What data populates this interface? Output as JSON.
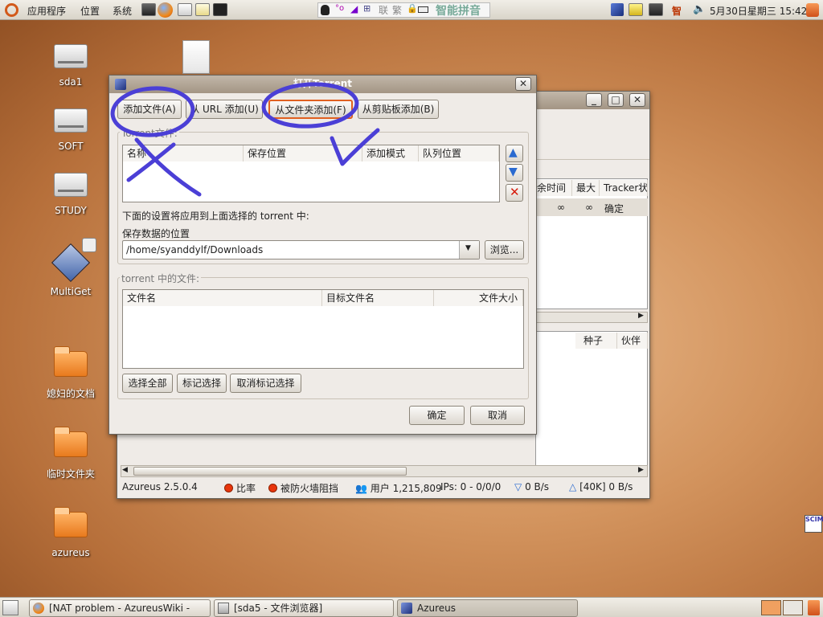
{
  "top_panel": {
    "menus": [
      "应用程序",
      "位置",
      "系统"
    ],
    "ime_label": "智能拼音",
    "ime_keys": [
      "联",
      "繁"
    ],
    "clock": "5月30日星期三 15:42",
    "zhi": "智"
  },
  "desktop": {
    "icons": [
      "sda1",
      "SOFT",
      "STUDY",
      "MultiGet",
      "媳妇的文档",
      "临时文件夹",
      "azureus"
    ],
    "scim": "SCIM"
  },
  "azureus_main": {
    "columns": [
      "余时间",
      "最大",
      "Tracker状"
    ],
    "row": [
      "∞",
      "∞",
      "确定"
    ],
    "lower_columns": [
      "种子",
      "伙伴"
    ],
    "status": {
      "version": "Azureus 2.5.0.4",
      "ratio": "比率",
      "firewall": "被防火墙阻挡",
      "users": "用户 1,215,809",
      "ips": "IPs: 0 - 0/0/0",
      "down": "0 B/s",
      "up": "[40K] 0 B/s"
    }
  },
  "dialog": {
    "title": "打开Torrent",
    "tabs": [
      "添加文件(A)",
      "从 URL 添加(U)",
      "从文件夹添加(F)",
      "从剪贴板添加(B)"
    ],
    "torrent_group": "Torrent文件:",
    "torrent_columns": [
      "名称",
      "保存位置",
      "添加模式",
      "队列位置"
    ],
    "settings_note": "下面的设置将应用到上面选择的 torrent 中:",
    "save_label": "保存数据的位置",
    "save_path": "/home/syanddylf/Downloads",
    "browse": "浏览...",
    "files_group": "torrent 中的文件:",
    "file_columns": [
      "文件名",
      "目标文件名",
      "文件大小"
    ],
    "select_all": "选择全部",
    "mark_selected": "标记选择",
    "unmark_selected": "取消标记选择",
    "ok": "确定",
    "cancel": "取消"
  },
  "taskbar": {
    "items": [
      "[NAT problem - AzureusWiki -",
      "[sda5 - 文件浏览器]",
      "Azureus"
    ]
  },
  "colors": {
    "panel": "#e4e0d8",
    "titlebar": "#b0a392",
    "annotation": "#4b3fd6",
    "highlight": "#e06020"
  }
}
